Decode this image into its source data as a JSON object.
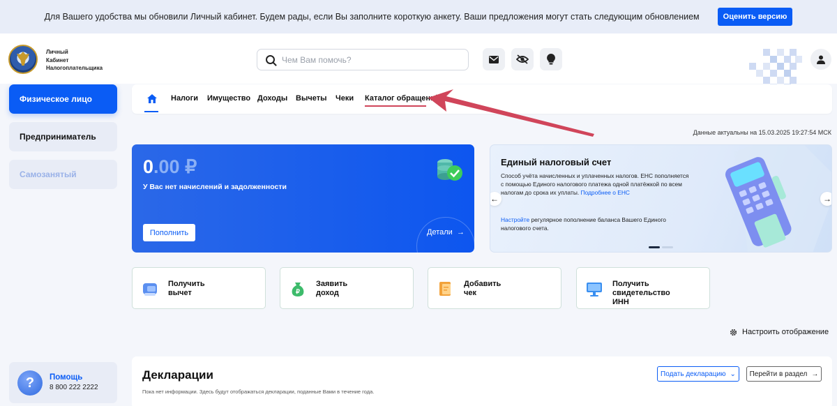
{
  "banner": {
    "text": "Для Вашего удобства мы обновили Личный кабинет. Будем рады, если Вы заполните короткую анкету. Ваши предложения могут стать следующим обновлением",
    "button": "Оценить версию"
  },
  "header": {
    "logo_line1": "Личный",
    "logo_line2": "Кабинет",
    "logo_line3": "Налогоплательщика",
    "search_placeholder": "Чем Вам помочь?"
  },
  "sidebar": {
    "items": [
      {
        "label": "Физическое лицо",
        "state": "active"
      },
      {
        "label": "Предприниматель",
        "state": "normal"
      },
      {
        "label": "Самозанятый",
        "state": "disabled"
      }
    ],
    "help_title": "Помощь",
    "help_phone": "8 800 222 2222"
  },
  "nav": {
    "items": [
      "Налоги",
      "Имущество",
      "Доходы",
      "Вычеты",
      "Чеки",
      "Каталог обращений"
    ]
  },
  "timestamp": "Данные актуальны на 15.03.2025 19:27:54 МСК",
  "balance": {
    "amount_int": "0",
    "amount_frac": ".00 ₽",
    "message": "У Вас нет начислений и задолженности",
    "topup_button": "Пополнить",
    "details_link": "Детали"
  },
  "ens": {
    "title": "Единый налоговый счет",
    "desc": "Способ учёта начисленных и уплаченных налогов. ЕНС пополняется с помощью Единого налогового платежа одной платёжкой по всем налогам до срока их уплаты.",
    "desc_link": "Подробнее о ЕНС",
    "setup_link": "Настройте",
    "setup_text": " регулярное пополнение баланса Вашего Единого налогового счета."
  },
  "quick_actions": [
    {
      "line1": "Получить",
      "line2": "вычет",
      "line3": ""
    },
    {
      "line1": "Заявить",
      "line2": "доход",
      "line3": ""
    },
    {
      "line1": "Добавить",
      "line2": "чек",
      "line3": ""
    },
    {
      "line1": "Получить",
      "line2": "свидетельство",
      "line3": "ИНН"
    }
  ],
  "configure_label": "Настроить отображение",
  "declarations": {
    "title": "Декларации",
    "note": "Пока нет информации. Здесь будут отображаться декларации, поданные Вами в течение года.",
    "submit_button": "Подать декларацию",
    "goto_button": "Перейти в раздел"
  },
  "colors": {
    "accent": "#0a5cf5",
    "annotation_arrow": "#d0455a"
  }
}
